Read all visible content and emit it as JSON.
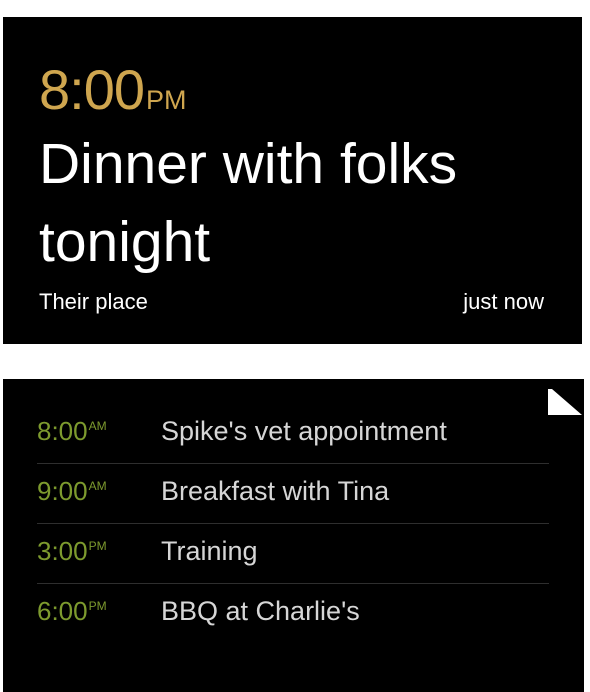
{
  "event_card": {
    "time": "8:00",
    "time_suffix": "PM",
    "title": "Dinner with folks tonight",
    "location": "Their place",
    "timestamp": "just now",
    "accent_color": "#cfa64f"
  },
  "agenda_card": {
    "accent_color": "#7d9a2e",
    "corner_icon": "page-fold-icon",
    "items": [
      {
        "time": "8:00",
        "suffix": "AM",
        "title": "Spike's vet appointment"
      },
      {
        "time": "9:00",
        "suffix": "AM",
        "title": "Breakfast with Tina"
      },
      {
        "time": "3:00",
        "suffix": "PM",
        "title": "Training"
      },
      {
        "time": "6:00",
        "suffix": "PM",
        "title": "BBQ at Charlie's"
      }
    ]
  }
}
